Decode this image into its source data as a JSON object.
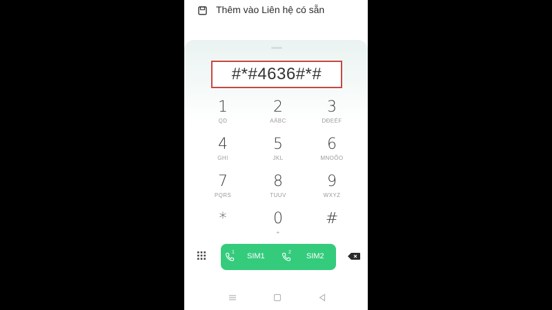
{
  "header": {
    "add_contact_label": "Thêm vào Liên hệ có sẵn"
  },
  "dialer": {
    "number": "#*#4636#*#",
    "keys": [
      {
        "digit": "1",
        "letters": "QD"
      },
      {
        "digit": "2",
        "letters": "AÄBC"
      },
      {
        "digit": "3",
        "letters": "DĐEÉF"
      },
      {
        "digit": "4",
        "letters": "GHI"
      },
      {
        "digit": "5",
        "letters": "JKL"
      },
      {
        "digit": "6",
        "letters": "MNOÔO"
      },
      {
        "digit": "7",
        "letters": "PQRS"
      },
      {
        "digit": "8",
        "letters": "TUUV"
      },
      {
        "digit": "9",
        "letters": "WXYZ"
      },
      {
        "digit": "*",
        "letters": ""
      },
      {
        "digit": "0",
        "letters": "+"
      },
      {
        "digit": "#",
        "letters": ""
      }
    ]
  },
  "call_bar": {
    "sim1": {
      "label": "SIM1",
      "badge": "1"
    },
    "sim2": {
      "label": "SIM2",
      "badge": "2"
    }
  },
  "colors": {
    "call_green": "#35cb7d",
    "highlight_border": "#c9463d"
  },
  "icons": [
    "save-icon",
    "dialpad-grid-icon",
    "phone-icon",
    "backspace-icon",
    "menu-icon",
    "home-icon",
    "back-icon"
  ]
}
